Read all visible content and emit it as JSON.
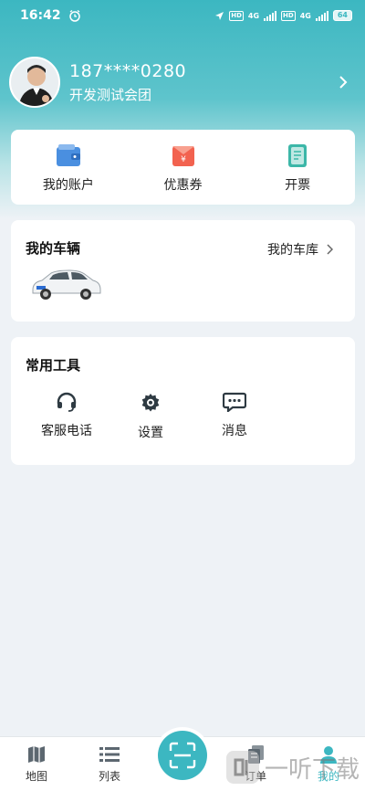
{
  "status_bar": {
    "time": "16:42",
    "network1": "4G",
    "network2": "4G",
    "hd": "HD",
    "battery": "64"
  },
  "profile": {
    "phone": "187****0280",
    "team": "开发测试会团"
  },
  "quick_actions": [
    {
      "label": "我的账户",
      "icon": "wallet-icon",
      "color": "#4a8fe0"
    },
    {
      "label": "优惠券",
      "icon": "coupon-icon",
      "color": "#f2624f"
    },
    {
      "label": "开票",
      "icon": "invoice-icon",
      "color": "#3cb7a8"
    }
  ],
  "vehicles": {
    "title": "我的车辆",
    "garage_link": "我的车库"
  },
  "tools": {
    "title": "常用工具",
    "items": [
      {
        "label": "客服电话",
        "icon": "headset-icon"
      },
      {
        "label": "设置",
        "icon": "gear-icon"
      },
      {
        "label": "消息",
        "icon": "message-icon"
      }
    ]
  },
  "tabbar": {
    "items": [
      {
        "label": "地图",
        "icon": "map-icon"
      },
      {
        "label": "列表",
        "icon": "list-icon"
      },
      {
        "label": "",
        "icon": "scan-icon"
      },
      {
        "label": "订单",
        "icon": "order-icon"
      },
      {
        "label": "我的",
        "icon": "user-icon"
      }
    ],
    "active": "我的"
  },
  "watermark": {
    "text": "一听下载"
  },
  "colors": {
    "accent": "#3cb7c1",
    "background": "#eef2f6"
  }
}
